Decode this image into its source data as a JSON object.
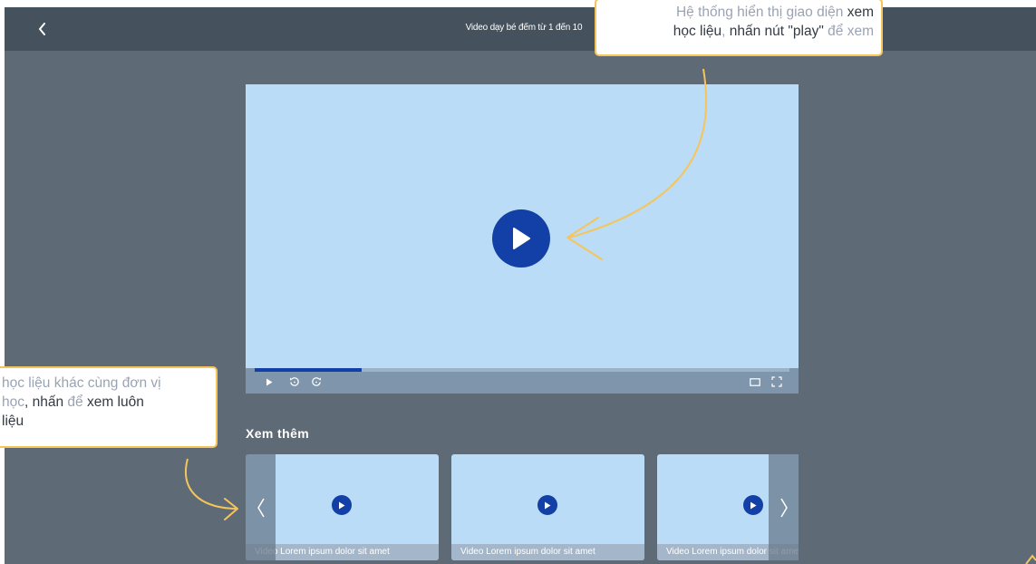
{
  "header": {
    "title": "Video dạy bé đếm từ 1 đến 10"
  },
  "player": {
    "progress": 0.2
  },
  "related": {
    "title": "Xem thêm",
    "items": [
      {
        "caption": "Video Lorem ipsum dolor sit amet"
      },
      {
        "caption": "Video Lorem ipsum dolor sit amet"
      },
      {
        "caption": "Video Lorem ipsum dolor sit amet"
      }
    ]
  },
  "annotations": {
    "top": {
      "l1a": "Hệ thống hiển thị giao diện ",
      "l1b": "xem",
      "l2a": "học liệu",
      "l2b": ", ",
      "l2c": "nhấn nút \"play\"",
      "l2d": " để xem"
    },
    "left": {
      "l1": "học liệu khác cùng đơn vị",
      "l2a": "học",
      "l2b": ", nhấn ",
      "l2c": "để",
      "l2d": " xem luôn",
      "l3": "liệu"
    }
  },
  "colors": {
    "accent": "#1240a6",
    "callout_border": "#f5c55b",
    "topbar": "#45525e",
    "background": "#5e6a75",
    "placeholder": "#bbdcf6"
  },
  "icons": {
    "back": "chevron-left-icon",
    "play": "play-icon",
    "rewind": "replay-icon",
    "forward": "forward-icon",
    "theater": "theater-mode-icon",
    "fullscreen": "fullscreen-icon",
    "prev": "chevron-left-icon",
    "next": "chevron-right-icon"
  }
}
